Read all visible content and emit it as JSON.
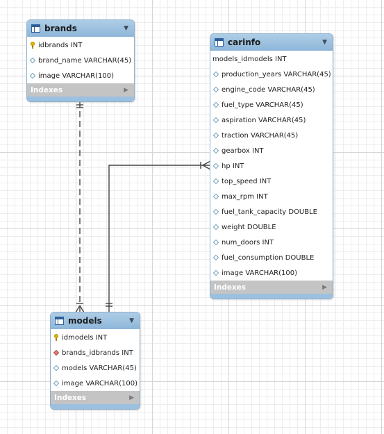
{
  "tables": {
    "brands": {
      "title": "brands",
      "indexes_label": "Indexes",
      "columns": [
        {
          "text": "idbrands INT",
          "icon": "primary-key-icon"
        },
        {
          "text": "brand_name VARCHAR(45)",
          "icon": "column-diamond-icon"
        },
        {
          "text": "image VARCHAR(100)",
          "icon": "column-diamond-icon"
        }
      ]
    },
    "carinfo": {
      "title": "carinfo",
      "indexes_label": "Indexes",
      "columns": [
        {
          "text": "models_idmodels INT",
          "icon": "none"
        },
        {
          "text": "production_years VARCHAR(45)",
          "icon": "column-diamond-icon"
        },
        {
          "text": "engine_code VARCHAR(45)",
          "icon": "column-diamond-icon"
        },
        {
          "text": "fuel_type VARCHAR(45)",
          "icon": "column-diamond-icon"
        },
        {
          "text": "aspiration VARCHAR(45)",
          "icon": "column-diamond-icon"
        },
        {
          "text": "traction VARCHAR(45)",
          "icon": "column-diamond-icon"
        },
        {
          "text": "gearbox INT",
          "icon": "column-diamond-icon"
        },
        {
          "text": "hp INT",
          "icon": "column-diamond-icon"
        },
        {
          "text": "top_speed INT",
          "icon": "column-diamond-icon"
        },
        {
          "text": "max_rpm INT",
          "icon": "column-diamond-icon"
        },
        {
          "text": "fuel_tank_capacity DOUBLE",
          "icon": "column-diamond-icon"
        },
        {
          "text": "weight DOUBLE",
          "icon": "column-diamond-icon"
        },
        {
          "text": "num_doors INT",
          "icon": "column-diamond-icon"
        },
        {
          "text": "fuel_consumption DOUBLE",
          "icon": "column-diamond-icon"
        },
        {
          "text": "image VARCHAR(100)",
          "icon": "column-diamond-icon"
        }
      ]
    },
    "models": {
      "title": "models",
      "indexes_label": "Indexes",
      "columns": [
        {
          "text": "idmodels INT",
          "icon": "primary-key-icon"
        },
        {
          "text": "brands_idbrands INT",
          "icon": "foreign-key-diamond-icon"
        },
        {
          "text": "models VARCHAR(45)",
          "icon": "column-diamond-icon"
        },
        {
          "text": "image VARCHAR(100)",
          "icon": "column-diamond-icon"
        }
      ]
    }
  },
  "relationships": [
    {
      "from": "brands",
      "to": "models",
      "style": "dashed",
      "from_end": "one-and-only-one",
      "to_end": "one-or-many"
    },
    {
      "from": "models",
      "to": "carinfo",
      "style": "solid",
      "from_end": "one-and-only-one",
      "to_end": "one-or-many"
    }
  ],
  "colors": {
    "header": "#9cc0df",
    "indexes_bar": "#c4c4c4",
    "line": "#444444"
  }
}
